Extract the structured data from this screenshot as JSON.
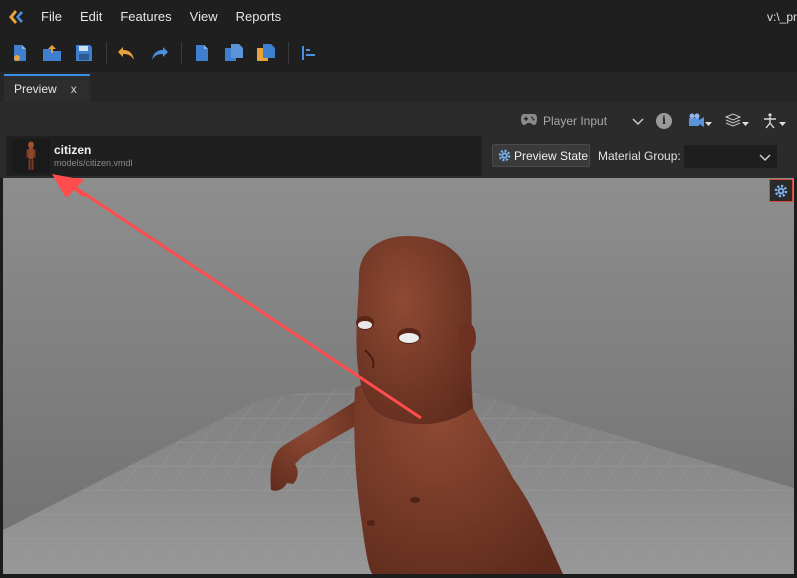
{
  "menubar": {
    "logo_icon": "sbox-logo-icon",
    "items": [
      "File",
      "Edit",
      "Features",
      "View",
      "Reports"
    ],
    "path_label": "v:\\_pr"
  },
  "toolbar": {
    "buttons": [
      "new-file-icon",
      "open-folder-icon",
      "save-icon",
      "undo-icon",
      "redo-icon",
      "new-document-icon",
      "copy-document-icon",
      "paste-document-icon",
      "align-left-icon"
    ]
  },
  "tabs": [
    {
      "label": "Preview",
      "close": "x",
      "active": true
    }
  ],
  "preview_bar": {
    "player_input_label": "Player Input",
    "info_glyph": "i"
  },
  "asset": {
    "name": "citizen",
    "path": "models/citizen.vmdl"
  },
  "preview_state": {
    "label": "Preview State"
  },
  "material_group": {
    "label": "Material Group:",
    "value": ""
  },
  "colors": {
    "accent": "#3a8ee6",
    "annotation_arrow": "#ff4d4d",
    "skin": "#7a3a28",
    "floor": "#8a8a8a"
  }
}
